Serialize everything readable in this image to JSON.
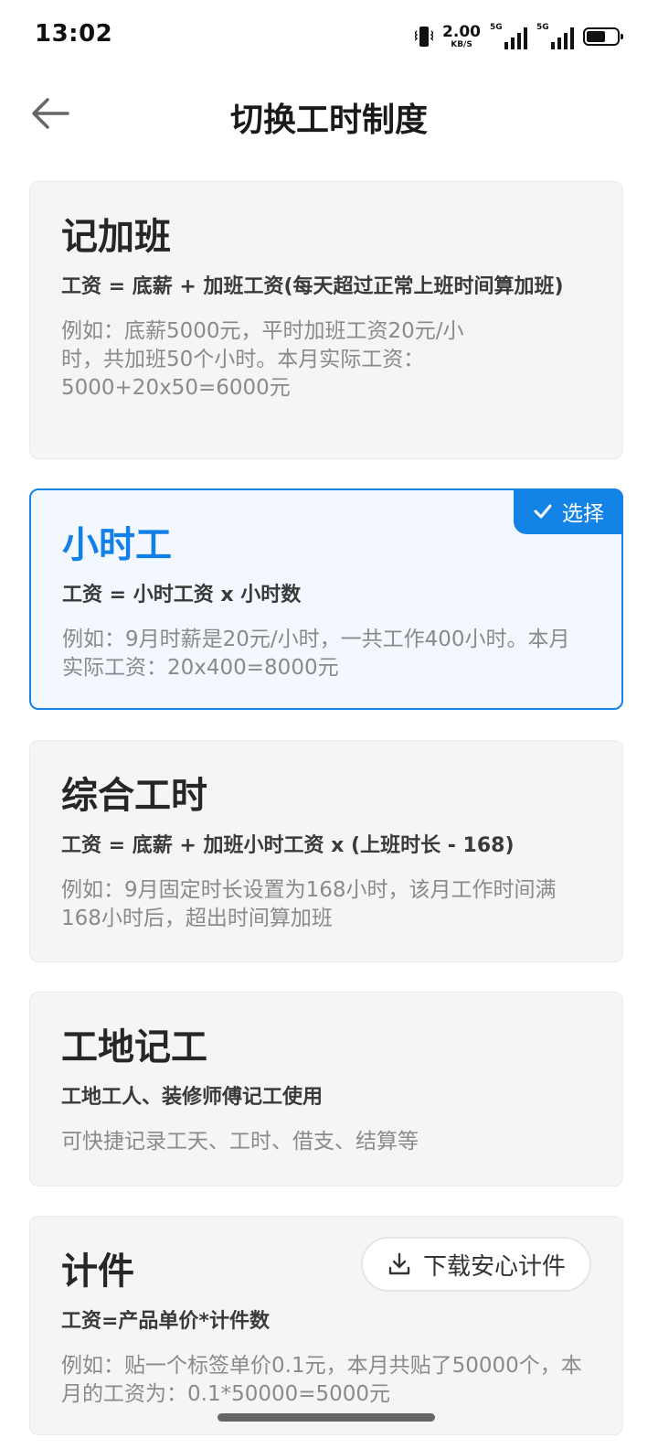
{
  "status_bar": {
    "time": "13:02",
    "net_speed_value": "2.00",
    "net_speed_unit": "KB/S",
    "signal_1_label": "5G",
    "signal_2_label": "5G",
    "battery_level": 0.68
  },
  "header": {
    "title": "切换工时制度",
    "back_icon": "arrow-left-icon"
  },
  "cards": [
    {
      "title": "记加班",
      "formula": "工资 = 底薪 + 加班工资(每天超过正常上班时间算加班)",
      "example": "例如：底薪5000元，平时加班工资20元/小时，共加班50个小时。本月实际工资：5000+20x50=6000元",
      "selected": false
    },
    {
      "title": "小时工",
      "formula": "工资 = 小时工资 x 小时数",
      "example": "例如：9月时薪是20元/小时，一共工作400小时。本月实际工资：20x400=8000元",
      "selected": true,
      "badge_label": "选择"
    },
    {
      "title": "综合工时",
      "formula": "工资 = 底薪 + 加班小时工资 x (上班时长 - 168)",
      "example": "例如：9月固定时长设置为168小时，该月工作时间满168小时后，超出时间算加班",
      "selected": false
    },
    {
      "title": "工地记工",
      "formula": "工地工人、装修师傅记工使用",
      "example": "可快捷记录工天、工时、借支、结算等",
      "selected": false
    },
    {
      "title": "计件",
      "formula": "工资=产品单价*计件数",
      "example": "例如：贴一个标签单价0.1元，本月共贴了50000个，本月的工资为：0.1*50000=5000元",
      "selected": false,
      "download_label": "下载安心计件"
    }
  ],
  "colors": {
    "accent": "#1483e6",
    "card_bg": "#f5f5f5",
    "selected_bg": "#f2f8fe"
  }
}
